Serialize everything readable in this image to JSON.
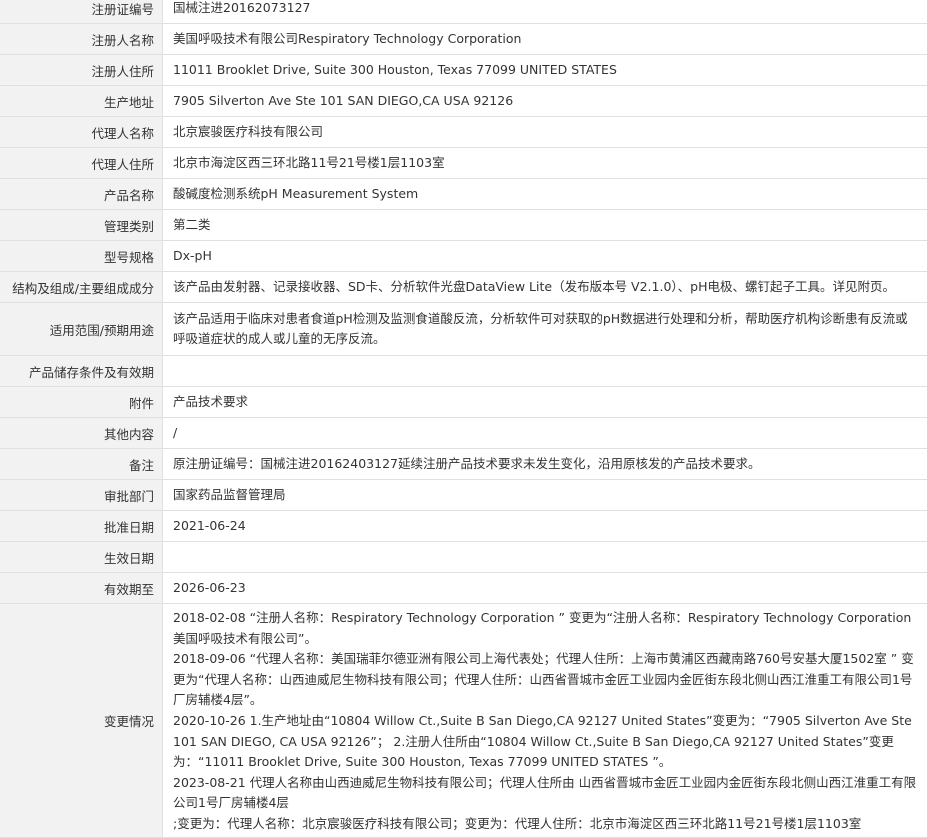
{
  "rows": [
    {
      "label": "注册证编号",
      "value": "国械注进20162073127"
    },
    {
      "label": "注册人名称",
      "value": "美国呼吸技术有限公司Respiratory Technology Corporation"
    },
    {
      "label": "注册人住所",
      "value": "11011 Brooklet Drive, Suite 300 Houston, Texas 77099 UNITED STATES"
    },
    {
      "label": "生产地址",
      "value": "7905 Silverton Ave Ste 101 SAN DIEGO,CA USA 92126"
    },
    {
      "label": "代理人名称",
      "value": "北京宸骏医疗科技有限公司"
    },
    {
      "label": "代理人住所",
      "value": "北京市海淀区西三环北路11号21号楼1层1103室"
    },
    {
      "label": "产品名称",
      "value": "酸碱度检测系统pH Measurement System"
    },
    {
      "label": "管理类别",
      "value": "第二类"
    },
    {
      "label": "型号规格",
      "value": "Dx-pH"
    },
    {
      "label": "结构及组成/主要组成成分",
      "value": "该产品由发射器、记录接收器、SD卡、分析软件光盘DataView Lite（发布版本号 V2.1.0）、pH电极、螺钉起子工具。详见附页。"
    },
    {
      "label": "适用范围/预期用途",
      "value": "该产品适用于临床对患者食道pH检测及监测食道酸反流，分析软件可对获取的pH数据进行处理和分析，帮助医疗机构诊断患有反流或呼吸道症状的成人或儿童的无序反流。"
    },
    {
      "label": "产品储存条件及有效期",
      "value": ""
    },
    {
      "label": "附件",
      "value": "产品技术要求"
    },
    {
      "label": "其他内容",
      "value": "/"
    },
    {
      "label": "备注",
      "value": "原注册证编号：国械注进20162403127延续注册产品技术要求未发生变化，沿用原核发的产品技术要求。"
    },
    {
      "label": "审批部门",
      "value": "国家药品监督管理局"
    },
    {
      "label": "批准日期",
      "value": "2021-06-24"
    },
    {
      "label": "生效日期",
      "value": ""
    },
    {
      "label": "有效期至",
      "value": "2026-06-23"
    }
  ],
  "changes": {
    "label": "变更情况",
    "entries": [
      "2018-02-08 “注册人名称：Respiratory Technology Corporation ” 变更为“注册人名称：Respiratory Technology Corporation 美国呼吸技术有限公司”。",
      "2018-09-06 “代理人名称：美国瑞菲尔德亚洲有限公司上海代表处；代理人住所：上海市黄浦区西藏南路760号安基大厦1502室 ” 变更为“代理人名称：山西迪威尼生物科技有限公司；代理人住所：山西省晋城市金匠工业园内金匠街东段北侧山西江淮重工有限公司1号厂房辅楼4层”。",
      "2020-10-26 1.生产地址由“10804 Willow Ct.,Suite B San Diego,CA 92127 United States”变更为：“7905 Silverton Ave Ste 101 SAN DIEGO, CA USA 92126”； 2.注册人住所由“10804 Willow Ct.,Suite B San Diego,CA 92127 United States”变更为：“11011 Brooklet Drive, Suite 300 Houston, Texas 77099 UNITED STATES ”。",
      "2023-08-21 代理人名称由山西迪威尼生物科技有限公司；代理人住所由 山西省晋城市金匠工业园内金匠街东段北侧山西江淮重工有限公司1号厂房辅楼4层",
      ";变更为：代理人名称：北京宸骏医疗科技有限公司；变更为：代理人住所：北京市海淀区西三环北路11号21号楼1层1103室"
    ]
  }
}
